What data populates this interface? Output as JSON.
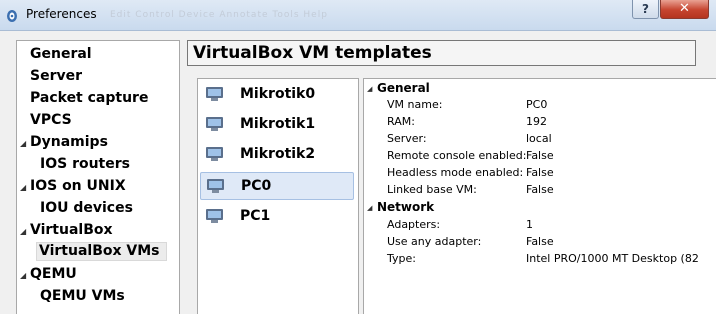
{
  "window": {
    "title": "Preferences",
    "help_label": "?",
    "close_label": "✕",
    "faint_menu_text": "Edit  Control  Device  Annotate  Tools  Help"
  },
  "nav": {
    "items": [
      {
        "label": "General"
      },
      {
        "label": "Server"
      },
      {
        "label": "Packet capture"
      },
      {
        "label": "VPCS"
      },
      {
        "label": "Dynamips"
      },
      {
        "label": "IOS routers"
      },
      {
        "label": "IOS on UNIX"
      },
      {
        "label": "IOU devices"
      },
      {
        "label": "VirtualBox"
      },
      {
        "label": "VirtualBox VMs"
      },
      {
        "label": "QEMU"
      },
      {
        "label": "QEMU VMs"
      }
    ],
    "selected": "VirtualBox VMs"
  },
  "header": {
    "title": "VirtualBox VM templates"
  },
  "vm_list": {
    "items": [
      {
        "label": "Mikrotik0"
      },
      {
        "label": "Mikrotik1"
      },
      {
        "label": "Mikrotik2"
      },
      {
        "label": "PC0"
      },
      {
        "label": "PC1"
      }
    ],
    "selected": "PC0"
  },
  "details": {
    "sections": [
      {
        "title": "General",
        "rows": [
          {
            "key": "VM name:",
            "value": "PC0"
          },
          {
            "key": "RAM:",
            "value": "192"
          },
          {
            "key": "Server:",
            "value": "local"
          },
          {
            "key": "Remote console enabled:",
            "value": "False"
          },
          {
            "key": "Headless mode enabled:",
            "value": "False"
          },
          {
            "key": "Linked base VM:",
            "value": "False"
          }
        ]
      },
      {
        "title": "Network",
        "rows": [
          {
            "key": "Adapters:",
            "value": "1"
          },
          {
            "key": "Use any adapter:",
            "value": "False"
          },
          {
            "key": "Type:",
            "value": "Intel PRO/1000 MT Desktop (82"
          }
        ]
      }
    ]
  },
  "colors": {
    "selection_fill": "#dfe9f7",
    "selection_border": "#a6c0e3",
    "close_button": "#c6442f"
  }
}
